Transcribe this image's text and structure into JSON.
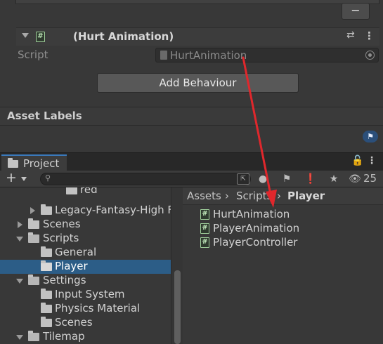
{
  "inspector": {
    "remove_button": "−",
    "component": {
      "title": "(Hurt Animation)",
      "script_icon": "#",
      "presets_icon": "⇄",
      "menu_icon": "⋮"
    },
    "script_label": "Script",
    "script_value": "HurtAnimation",
    "add_behaviour_label": "Add Behaviour",
    "asset_labels_heading": "Asset Labels",
    "tag_icon": "tag-icon"
  },
  "project": {
    "tab_label": "Project",
    "lock_icon": "lock-icon",
    "menu_icon": "⋮",
    "toolbar": {
      "plus": "+",
      "search_placeholder": "",
      "hidden_count": "25"
    },
    "tree": [
      {
        "label": "red",
        "depth": 4
      },
      {
        "label": "Legacy-Fantasy-High F",
        "depth": 3,
        "state": "closed"
      },
      {
        "label": "Scenes",
        "depth": 2,
        "state": "closed"
      },
      {
        "label": "Scripts",
        "depth": 2,
        "state": "open"
      },
      {
        "label": "General",
        "depth": 3
      },
      {
        "label": "Player",
        "depth": 3,
        "selected": true
      },
      {
        "label": "Settings",
        "depth": 2,
        "state": "open"
      },
      {
        "label": "Input System",
        "depth": 3
      },
      {
        "label": "Physics Material",
        "depth": 3
      },
      {
        "label": "Scenes",
        "depth": 3
      },
      {
        "label": "Tilemap",
        "depth": 2,
        "state": "open"
      }
    ],
    "breadcrumb": {
      "assets": "Assets",
      "sep1": "›",
      "scripts": "Scripts",
      "sep2": "›",
      "player": "Player"
    },
    "assets": [
      {
        "name": "HurtAnimation"
      },
      {
        "name": "PlayerAnimation"
      },
      {
        "name": "PlayerController"
      }
    ]
  },
  "colors": {
    "annotation_arrow": "#e0272c",
    "selection": "#2c5d87"
  }
}
